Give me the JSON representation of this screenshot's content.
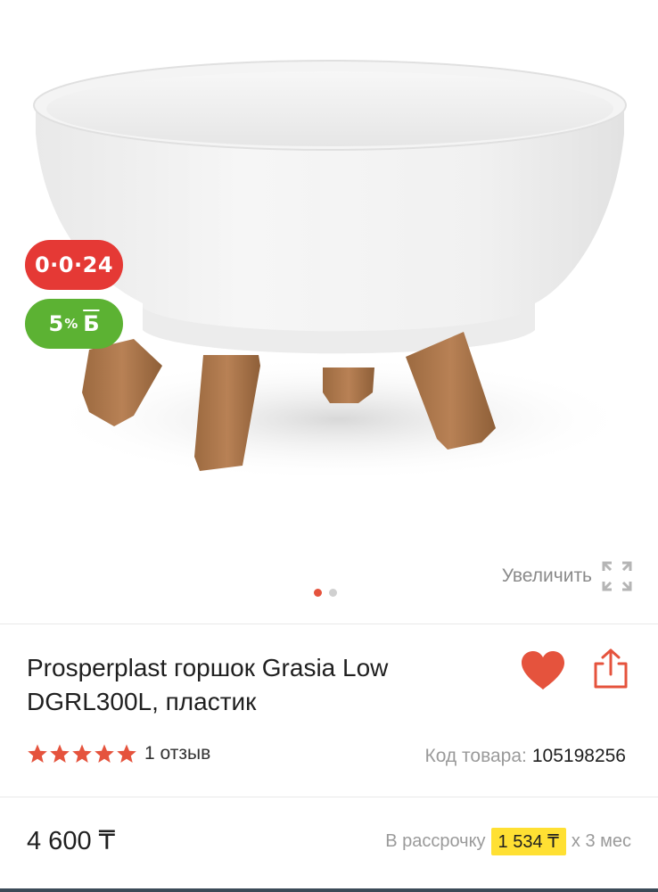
{
  "gallery": {
    "badges": {
      "installment": "0·0·24",
      "bonus_value": "5",
      "bonus_pct": "%",
      "bonus_symbol": "Б"
    },
    "zoom_label": "Увеличить",
    "zoom_icon": "expand-icon",
    "dots": {
      "count": 2,
      "active_index": 0
    }
  },
  "product": {
    "title_line1": "Prosperplast горшок Grasia Low",
    "title_line2": "DGRL300L, пластик",
    "rating_stars": 5,
    "reviews": "1 отзыв",
    "code_label": "Код товара:",
    "code_value": "105198256",
    "price": "4 600 ₸",
    "installment_label": "В рассрочку",
    "installment_amount": "1 534 ₸",
    "installment_term": "x 3 мес"
  },
  "colors": {
    "accent_red": "#e5533d",
    "installment_badge": "#e53935",
    "bonus_badge": "#5cb233",
    "installment_highlight": "#ffe033",
    "star": "#e5533d"
  },
  "icons": [
    "heart-icon",
    "share-icon",
    "star-icon",
    "expand-icon"
  ]
}
